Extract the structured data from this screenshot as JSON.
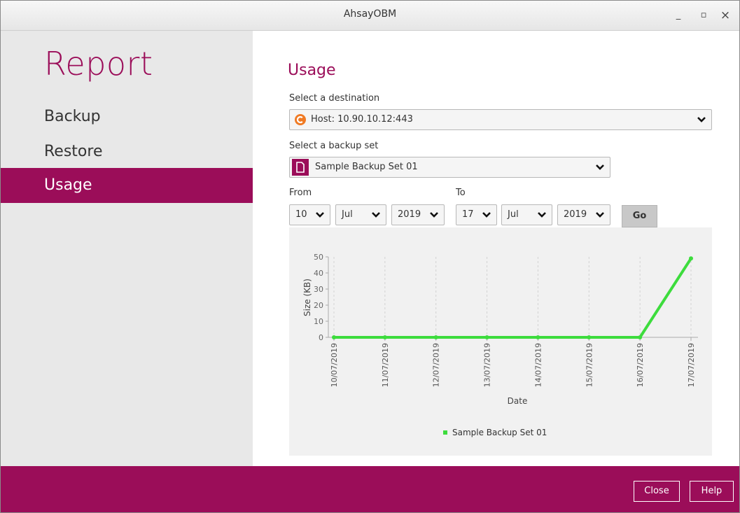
{
  "window": {
    "title": "AhsayOBM",
    "minimize": "_",
    "maximize": "▫",
    "close": "×"
  },
  "sidebar": {
    "heading": "Report",
    "items": [
      {
        "label": "Backup",
        "active": false
      },
      {
        "label": "Restore",
        "active": false
      },
      {
        "label": "Usage",
        "active": true
      }
    ]
  },
  "main": {
    "heading": "Usage",
    "destination": {
      "label": "Select a destination",
      "value": "Host: 10.90.10.12:443"
    },
    "backup_set": {
      "label": "Select a backup set",
      "value": "Sample Backup Set 01"
    },
    "from": {
      "label": "From",
      "day": "10",
      "month": "Jul",
      "year": "2019"
    },
    "to": {
      "label": "To",
      "day": "17",
      "month": "Jul",
      "year": "2019"
    },
    "go_label": "Go"
  },
  "chart_data": {
    "type": "line",
    "title": "",
    "xlabel": "Date",
    "ylabel": "Size (KB)",
    "x": [
      "10/07/2019",
      "11/07/2019",
      "12/07/2019",
      "13/07/2019",
      "14/07/2019",
      "15/07/2019",
      "16/07/2019",
      "17/07/2019"
    ],
    "series": [
      {
        "name": "Sample Backup Set 01",
        "values": [
          0,
          0,
          0,
          0,
          0,
          0,
          0,
          49
        ]
      }
    ],
    "ylim": [
      0,
      50
    ],
    "yticks": [
      0,
      10,
      20,
      30,
      40,
      50
    ],
    "grid": "vertical dashed",
    "legend": "bottom",
    "color": "#3ddc3d"
  },
  "footer": {
    "close_label": "Close",
    "help_label": "Help"
  },
  "colors": {
    "accent": "#9b0d59",
    "destination_icon": "#f07a23"
  }
}
